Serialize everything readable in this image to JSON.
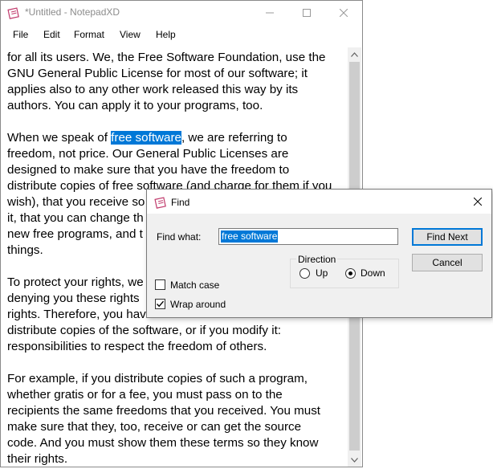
{
  "window": {
    "title": "*Untitled - NotepadXD",
    "minimize_glyph": "—",
    "maximize_glyph": "☐",
    "close_glyph": "✕"
  },
  "menu": [
    "File",
    "Edit",
    "Format",
    "View",
    "Help"
  ],
  "editor": {
    "lines": [
      "for all its users. We, the Free Software Foundation, use the",
      "GNU General Public License for most of our software; it",
      "applies also to any other work released this way by its",
      "authors. You can apply it to your programs, too.",
      "",
      "When we speak of free software, we are referring to",
      "freedom, not price. Our General Public Licenses are",
      "designed to make sure that you have the freedom to",
      "distribute copies of free software (and charge for them if you",
      "wish), that you receive so",
      "it, that you can change th",
      "new free programs, and t",
      "things.",
      "",
      "To protect your rights, we",
      "denying you these rights",
      "rights. Therefore, you hav",
      "distribute copies of the software, or if you modify it:",
      "responsibilities to respect the freedom of others.",
      "",
      "For example, if you distribute copies of such a program,",
      "whether gratis or for a fee, you must pass on to the",
      "recipients the same freedoms that you received. You must",
      "make sure that they, too, receive or can get the source",
      "code. And you must show them these terms so they know",
      "their rights."
    ],
    "selected_line": {
      "before": "When we speak of ",
      "selected": "free software",
      "after": ", we are referring to"
    }
  },
  "find_dialog": {
    "title": "Find",
    "find_what_label": "Find what:",
    "find_what_value": "free software",
    "find_next_label": "Find Next",
    "cancel_label": "Cancel",
    "direction_label": "Direction",
    "up_label": "Up",
    "down_label": "Down",
    "direction_selected": "Down",
    "match_case_label": "Match case",
    "match_case_checked": false,
    "wrap_around_label": "Wrap around",
    "wrap_around_checked": true,
    "close_glyph": "✕"
  },
  "colors": {
    "selection": "#0078d7",
    "dialog_bg": "#f0f0f0"
  }
}
